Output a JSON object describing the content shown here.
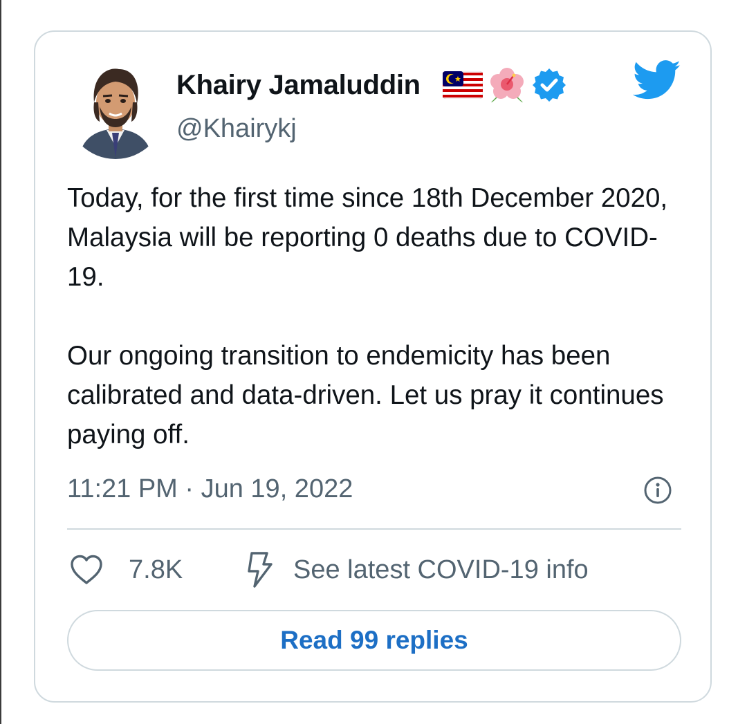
{
  "tweet": {
    "author_name": "Khairy Jamaluddin",
    "handle": "@Khairykj",
    "badges": [
      "malaysia-flag-icon",
      "hibiscus-icon",
      "verified-badge-icon"
    ],
    "paragraphs": [
      "Today, for the first time since 18th December 2020, Malaysia will be reporting 0 deaths due to COVID-19.",
      "Our ongoing transition to endemicity has been calibrated and data-driven. Let us pray it continues paying off."
    ],
    "timestamp": "11:21 PM · Jun 19, 2022",
    "likes": "7.8K",
    "covid_info_label": "See latest COVID-19 info",
    "read_replies_label": "Read 99 replies"
  },
  "colors": {
    "brand_blue": "#1d9bf0",
    "link_blue": "#1d6fc5",
    "secondary_text": "#536471",
    "border": "#cfd9de"
  }
}
